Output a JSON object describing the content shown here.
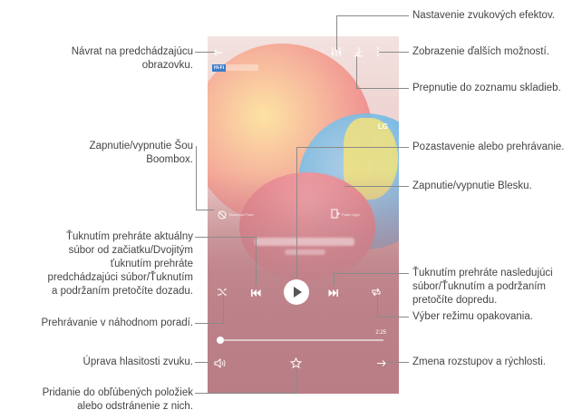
{
  "screen": {
    "hires_badge": "Hi-Fi",
    "logo_text": "LG",
    "boombox_caption": "Boombox Face",
    "flash_caption": "Flash Light",
    "time_total": "2:25",
    "icons": {
      "back": "arrow-left-icon",
      "equalizer": "equalizer-icon",
      "playlist": "playlist-icon",
      "more": "more-vertical-icon",
      "boombox": "boombox-icon",
      "flash": "flash-icon",
      "shuffle": "shuffle-icon",
      "previous": "skip-previous-icon",
      "play": "play-icon",
      "next": "skip-next-icon",
      "repeat": "repeat-icon",
      "volume": "volume-icon",
      "favorite": "star-icon",
      "pitch": "pitch-speed-icon"
    }
  },
  "annotations": {
    "back": [
      "Návrat na predchádzajúcu",
      "obrazovku."
    ],
    "sound_effects": [
      "Nastavenie zvukových efektov."
    ],
    "more_options": [
      "Zobrazenie ďalších možností."
    ],
    "playlist": [
      "Prepnutie do zoznamu skladieb."
    ],
    "boombox": [
      "Zapnutie/vypnutie Šou",
      "Boombox."
    ],
    "pause_play": [
      "Pozastavenie alebo prehrávanie."
    ],
    "flash": [
      "Zapnutie/vypnutie Blesku."
    ],
    "previous": [
      "Ťuknutím prehráte aktuálny",
      "súbor od začiatku/Dvojitým",
      "ťuknutím prehráte",
      "predchádzajúci súbor/Ťuknutím",
      "a podržaním pretočíte dozadu."
    ],
    "next": [
      "Ťuknutím prehráte nasledujúci",
      "súbor/Ťuknutím a podržaním",
      "pretočíte dopredu."
    ],
    "shuffle": [
      "Prehrávanie v náhodnom poradí."
    ],
    "repeat": [
      "Výber režimu opakovania."
    ],
    "volume": [
      "Úprava hlasitosti zvuku."
    ],
    "pitch_speed": [
      "Zmena rozstupov a rýchlosti."
    ],
    "favorite": [
      "Pridanie do obľúbených položiek",
      "alebo odstránenie z nich."
    ]
  }
}
